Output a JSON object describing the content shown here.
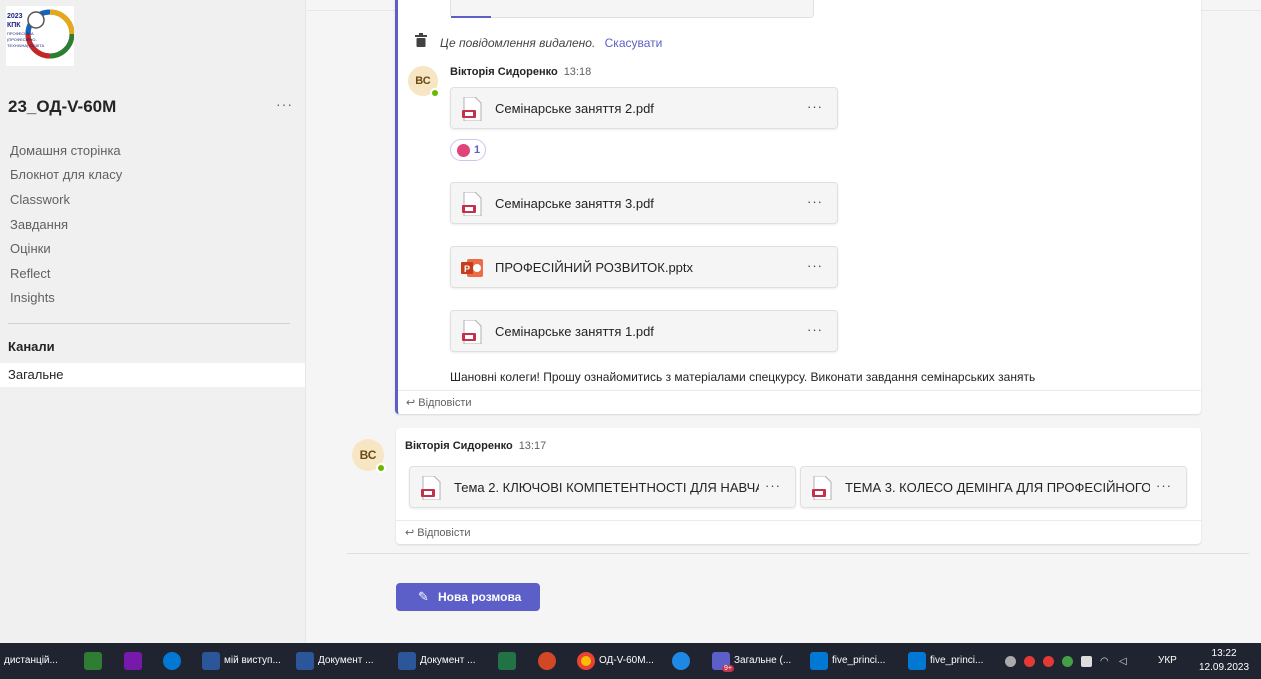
{
  "team": {
    "logo_text": "2023 КПК ПРОФЕСІЙНА (ПРОФЕСІЙНО-ТЕХНІЧНА) ОСВІТА",
    "name": "23_ОД-V-60М",
    "more": "···"
  },
  "nav": [
    {
      "label": "Домашня сторінка"
    },
    {
      "label": "Блокнот для класу"
    },
    {
      "label": "Classwork"
    },
    {
      "label": "Завдання"
    },
    {
      "label": "Оцінки"
    },
    {
      "label": "Reflect"
    },
    {
      "label": "Insights"
    }
  ],
  "channels": {
    "heading": "Канали",
    "items": [
      {
        "label": "Загальне"
      }
    ]
  },
  "thread1": {
    "deleted_text": "Це повідомлення видалено.",
    "undo_label": "Скасувати",
    "author": "Вікторія Сидоренко",
    "time": "13:18",
    "avatar": "ВС",
    "files": [
      {
        "name": "Семінарське заняття 2.pdf",
        "type": "pdf"
      },
      {
        "name": "Семінарське заняття 3.pdf",
        "type": "pdf"
      },
      {
        "name": "ПРОФЕСІЙНИЙ РОЗВИТОК.pptx",
        "type": "pptx"
      },
      {
        "name": "Семінарське заняття 1.pdf",
        "type": "pdf"
      }
    ],
    "reaction_count": "1",
    "message": "Шановні колеги! Прошу ознайомитись з матеріалами спецкурсу. Виконати завдання семінарських занять",
    "reply_label": "Відповісти"
  },
  "thread2": {
    "author": "Вікторія Сидоренко",
    "time": "13:17",
    "avatar": "ВС",
    "files": [
      {
        "name": "Тема 2. КЛЮЧОВІ КОМПЕТЕНТНОСТІ ДЛЯ НАВЧА...",
        "type": "pdf"
      },
      {
        "name": "ТЕМА 3. КОЛЕСО ДЕМІНГА ДЛЯ ПРОФЕСІЙНОГО Р...",
        "type": "pdf"
      }
    ],
    "reply_label": "Відповісти"
  },
  "new_conversation": {
    "label": "Нова розмова"
  },
  "file_more": "···",
  "taskbar": {
    "items": [
      {
        "label": "дистанцій...",
        "icon": "app-icon"
      },
      {
        "label": "",
        "icon": "app-icon-2"
      },
      {
        "label": "",
        "icon": "onenote-icon"
      },
      {
        "label": "",
        "icon": "skype-icon"
      },
      {
        "label": "мій виступ...",
        "icon": "word-icon"
      },
      {
        "label": "Документ ...",
        "icon": "word-icon"
      },
      {
        "label": "Документ ...",
        "icon": "word-icon"
      },
      {
        "label": "",
        "icon": "excel-icon"
      },
      {
        "label": "",
        "icon": "powerpoint-icon"
      },
      {
        "label": "ОД-V-60М...",
        "icon": "chrome-icon"
      },
      {
        "label": "",
        "icon": "edge-icon"
      },
      {
        "label": "Загальне (...",
        "icon": "teams-icon"
      },
      {
        "label": "five_princi...",
        "icon": "photos-icon"
      },
      {
        "label": "five_princi...",
        "icon": "photos-icon"
      }
    ],
    "teams_badge": "9+",
    "language": "УКР",
    "time": "13:22",
    "date": "12.09.2023"
  },
  "colors": {
    "accent": "#5b5fc7",
    "presence": "#6bb700",
    "pdf": "#c4314b",
    "pptx": "#c43e1c"
  }
}
